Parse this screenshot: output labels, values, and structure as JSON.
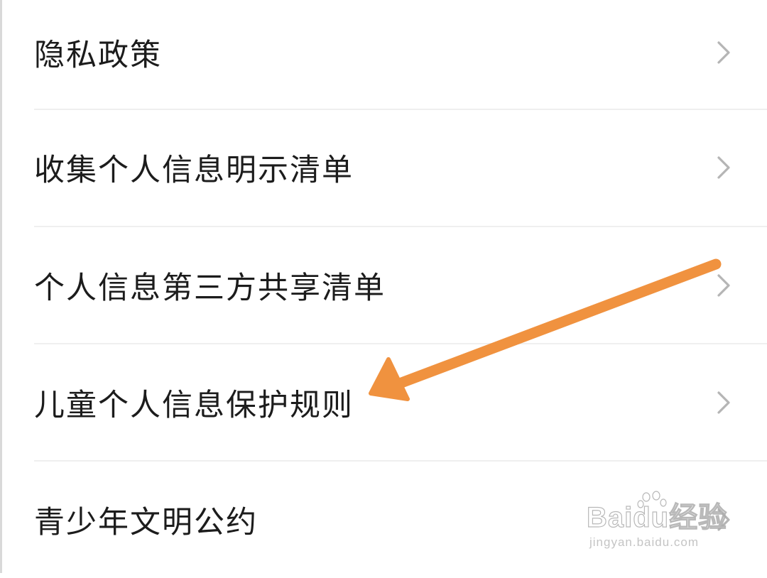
{
  "menu": {
    "items": [
      {
        "label": "隐私政策",
        "chevron_icon": "chevron-right-icon"
      },
      {
        "label": "收集个人信息明示清单",
        "chevron_icon": "chevron-right-icon"
      },
      {
        "label": "个人信息第三方共享清单",
        "chevron_icon": "chevron-right-icon"
      },
      {
        "label": "儿童个人信息保护规则",
        "chevron_icon": "chevron-right-icon"
      },
      {
        "label": "青少年文明公约",
        "chevron_icon": "chevron-right-icon"
      }
    ]
  },
  "annotation": {
    "icon": "arrow-icon",
    "color": "#f0923f",
    "points_to": "儿童个人信息保护规则"
  },
  "watermark": {
    "brand": "Baidu经验",
    "url": "jingyan.baidu.com"
  },
  "colors": {
    "text": "#1c1c1c",
    "chevron": "#b5b5b5",
    "divider": "#efefef",
    "background": "#ffffff"
  }
}
